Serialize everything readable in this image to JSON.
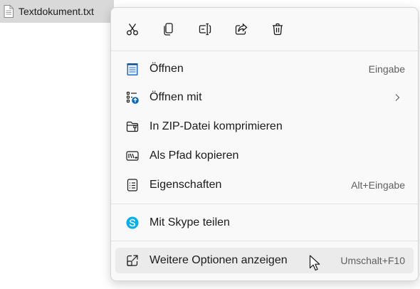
{
  "file": {
    "name": "Textdokument.txt",
    "icon": "text-file-icon"
  },
  "toolbar": {
    "buttons": [
      {
        "name": "cut",
        "icon": "scissors-icon"
      },
      {
        "name": "copy",
        "icon": "copy-icon"
      },
      {
        "name": "rename",
        "icon": "rename-icon"
      },
      {
        "name": "share",
        "icon": "share-icon"
      },
      {
        "name": "delete",
        "icon": "trash-icon"
      }
    ]
  },
  "menu": {
    "items": [
      {
        "label": "Öffnen",
        "shortcut": "Eingabe",
        "icon": "notepad-icon"
      },
      {
        "label": "Öffnen mit",
        "shortcut": "",
        "icon": "open-with-icon",
        "submenu": true
      },
      {
        "label": "In ZIP-Datei komprimieren",
        "shortcut": "",
        "icon": "zip-folder-icon"
      },
      {
        "label": "Als Pfad kopieren",
        "shortcut": "",
        "icon": "copy-path-icon"
      },
      {
        "label": "Eigenschaften",
        "shortcut": "Alt+Eingabe",
        "icon": "properties-icon"
      },
      {
        "label": "Mit Skype teilen",
        "shortcut": "",
        "icon": "skype-icon"
      },
      {
        "label": "Weitere Optionen anzeigen",
        "shortcut": "Umschalt+F10",
        "icon": "more-options-icon",
        "highlighted": true
      }
    ]
  },
  "colors": {
    "accent": "#0067c0",
    "skype": "#00aff0",
    "menu_bg": "#f9f9f9",
    "hover_bg": "#ebebeb"
  }
}
